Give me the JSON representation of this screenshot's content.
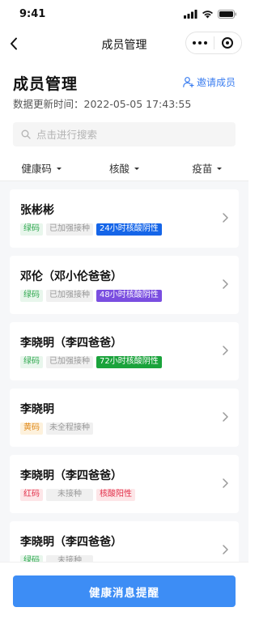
{
  "status_bar": {
    "time": "9:41",
    "icons": [
      "signal-icon",
      "wifi-icon",
      "battery-icon"
    ]
  },
  "nav": {
    "title": "成员管理",
    "back_icon": "chevron-left-icon",
    "capsule_icons": [
      "more-icon",
      "close-miniprogram-icon"
    ]
  },
  "header": {
    "title": "成员管理",
    "invite_label": "邀请成员",
    "invite_icon": "add-person-icon",
    "update_label": "数据更新时间：",
    "update_time": "2022-05-05 17:43:55"
  },
  "search": {
    "placeholder": "点击进行搜索",
    "value": "",
    "icon": "search-icon"
  },
  "filters": [
    {
      "label": "健康码"
    },
    {
      "label": "核酸"
    },
    {
      "label": "疫苗"
    }
  ],
  "members": [
    {
      "name": "张彬彬",
      "tags": [
        {
          "text": "绿码",
          "style": "green"
        },
        {
          "text": "已加强接种",
          "style": "gray"
        },
        {
          "text": "24小时核酸阴性",
          "style": "blue-solid"
        }
      ]
    },
    {
      "name": "邓伦（邓小伦爸爸）",
      "tags": [
        {
          "text": "绿码",
          "style": "green"
        },
        {
          "text": "已加强接种",
          "style": "gray"
        },
        {
          "text": "48小时核酸阴性",
          "style": "purple-solid"
        }
      ]
    },
    {
      "name": "李晓明（李四爸爸）",
      "tags": [
        {
          "text": "绿码",
          "style": "green"
        },
        {
          "text": "已加强接种",
          "style": "gray"
        },
        {
          "text": "72小时核酸阴性",
          "style": "green-solid"
        }
      ]
    },
    {
      "name": "李晓明",
      "tags": [
        {
          "text": "黄码",
          "style": "yellow"
        },
        {
          "text": "未全程接种",
          "style": "gray"
        }
      ]
    },
    {
      "name": "李晓明（李四爸爸）",
      "tags": [
        {
          "text": "红码",
          "style": "red"
        },
        {
          "text": "未接种",
          "style": "gray"
        },
        {
          "text": "核酸阳性",
          "style": "red-soft"
        }
      ]
    },
    {
      "name": "李晓明（李四爸爸）",
      "tags": [
        {
          "text": "绿码",
          "style": "green"
        },
        {
          "text": "未接种",
          "style": "gray"
        }
      ]
    }
  ],
  "footer": {
    "button_label": "健康消息提醒"
  },
  "colors": {
    "accent": "#3d8df5",
    "link": "#3a7df0",
    "green_code": "#2fa84f",
    "yellow_code": "#e0891a",
    "red_code": "#e2314b"
  }
}
